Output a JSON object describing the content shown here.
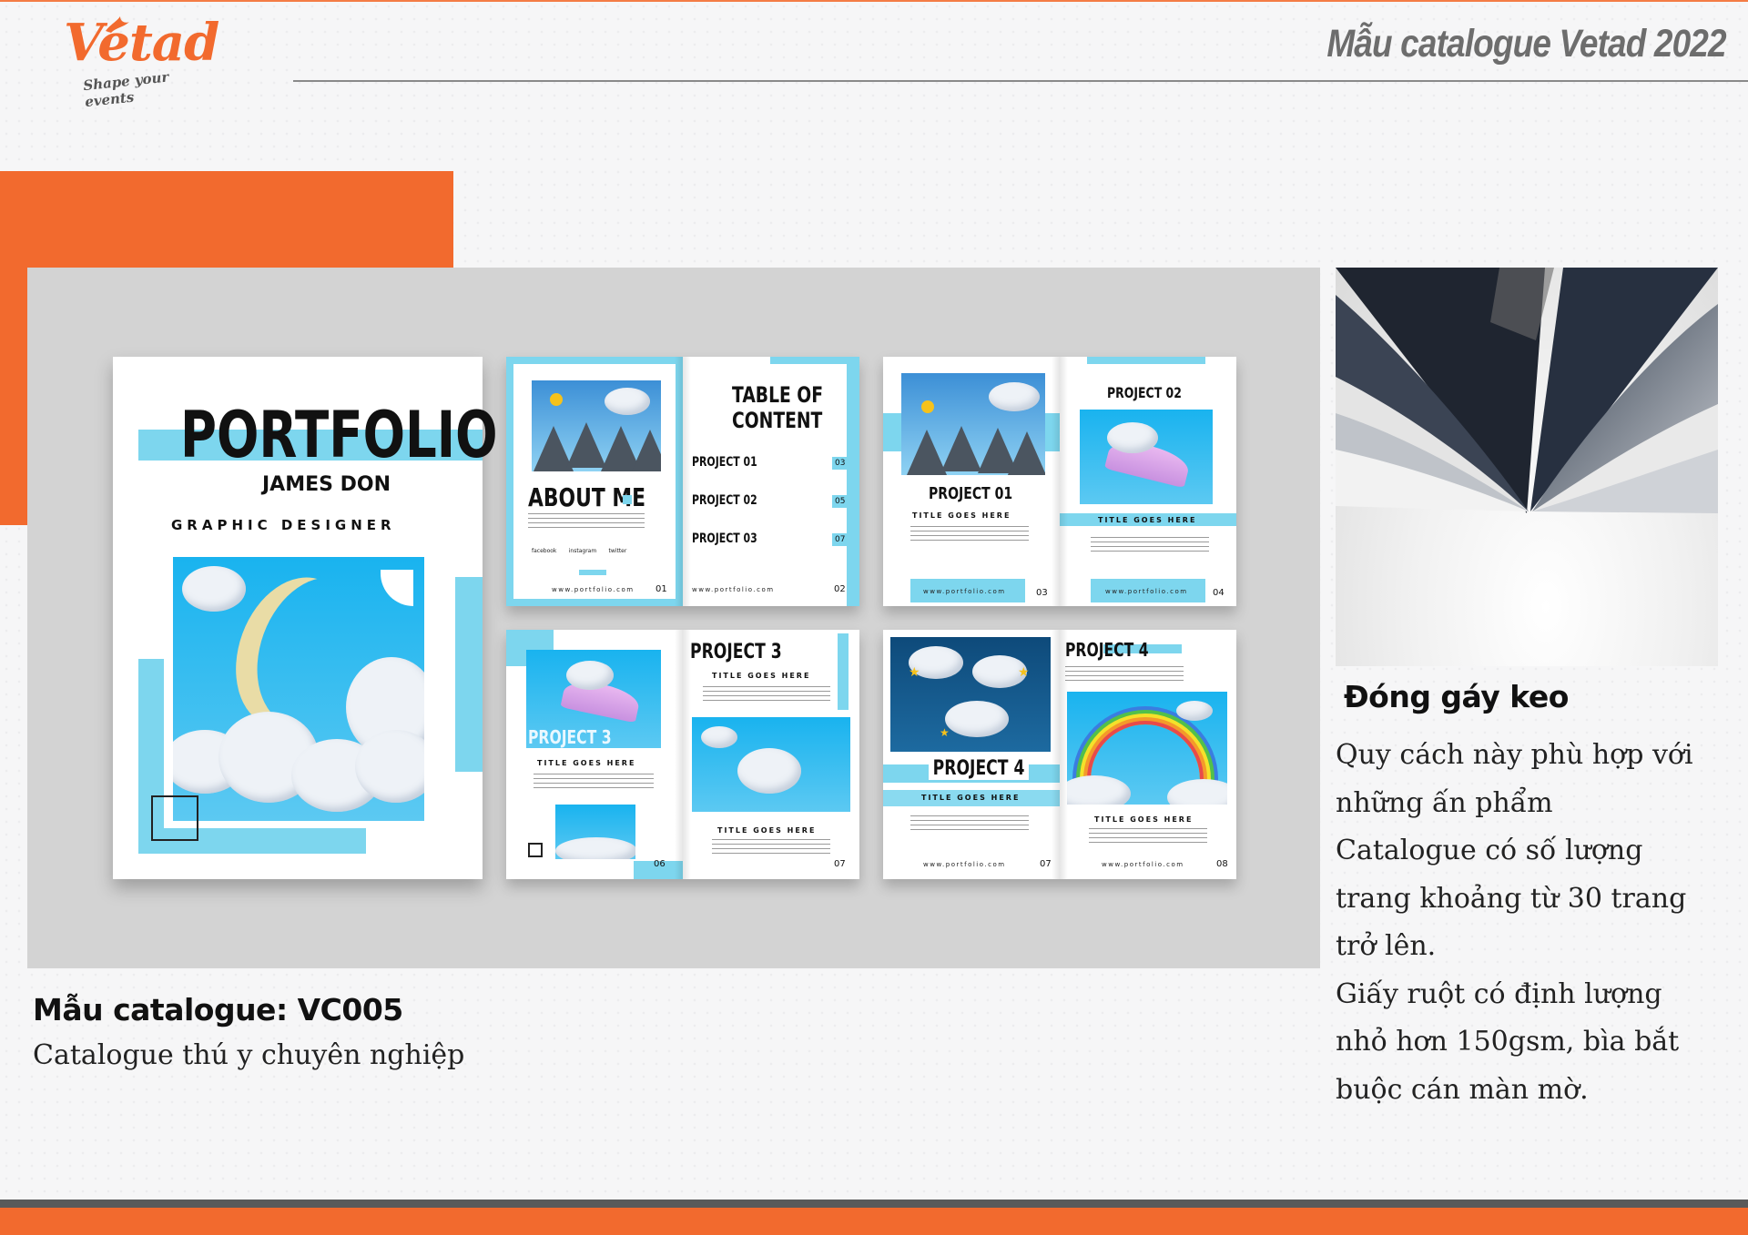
{
  "header": {
    "logo_text": "Vetad",
    "logo_tagline": "Shape your events",
    "title": "Mẫu catalogue Vetad 2022"
  },
  "catalogue": {
    "title": "Mẫu catalogue: VC005",
    "subtitle": "Catalogue thú y chuyên nghiệp"
  },
  "mockup": {
    "cover": {
      "title": "PORTFOLIO",
      "name": "JAMES DON",
      "role": "GRAPHIC DESIGNER"
    },
    "spread1": {
      "about": "ABOUT ME",
      "toc_title_1": "TABLE OF",
      "toc_title_2": "CONTENT",
      "toc": [
        {
          "label": "PROJECT 01",
          "page": "03"
        },
        {
          "label": "PROJECT 02",
          "page": "05"
        },
        {
          "label": "PROJECT 03",
          "page": "07"
        }
      ],
      "social": [
        "facebook",
        "instagram",
        "twitter"
      ],
      "url": "www.portfolio.com",
      "left_page": "01",
      "right_page": "02"
    },
    "spread2": {
      "left_title": "PROJECT 01",
      "left_sub": "TITLE GOES HERE",
      "right_title": "PROJECT 02",
      "right_sub": "TITLE GOES HERE",
      "url": "www.portfolio.com",
      "left_page": "03",
      "right_page": "04"
    },
    "spread3": {
      "left_title": "PROJECT 3",
      "left_sub": "TITLE GOES HERE",
      "right_title": "PROJECT 3",
      "right_sub_top": "TITLE GOES HERE",
      "right_sub_bottom": "TITLE GOES HERE",
      "left_page": "06",
      "right_page": "07"
    },
    "spread4": {
      "left_title": "PROJECT 4",
      "left_sub": "TITLE GOES HERE",
      "right_title": "PROJECT 4",
      "right_sub": "TITLE GOES HERE",
      "url": "www.portfolio.com",
      "left_page": "07",
      "right_page": "08"
    }
  },
  "binding": {
    "title": "Đóng gáy keo",
    "lines": [
      "Quy cách này phù hợp với",
      "những ấn phẩm",
      "Catalogue có số lượng",
      "trang khoảng từ 30 trang",
      "trở lên.",
      "Giấy ruột có định lượng",
      "nhỏ hơn 150gsm, bìa bắt",
      "buộc cán màn mờ."
    ]
  },
  "colors": {
    "accent": "#f26a2e",
    "cyan": "#7dd6ee",
    "panel": "#d3d3d3"
  }
}
